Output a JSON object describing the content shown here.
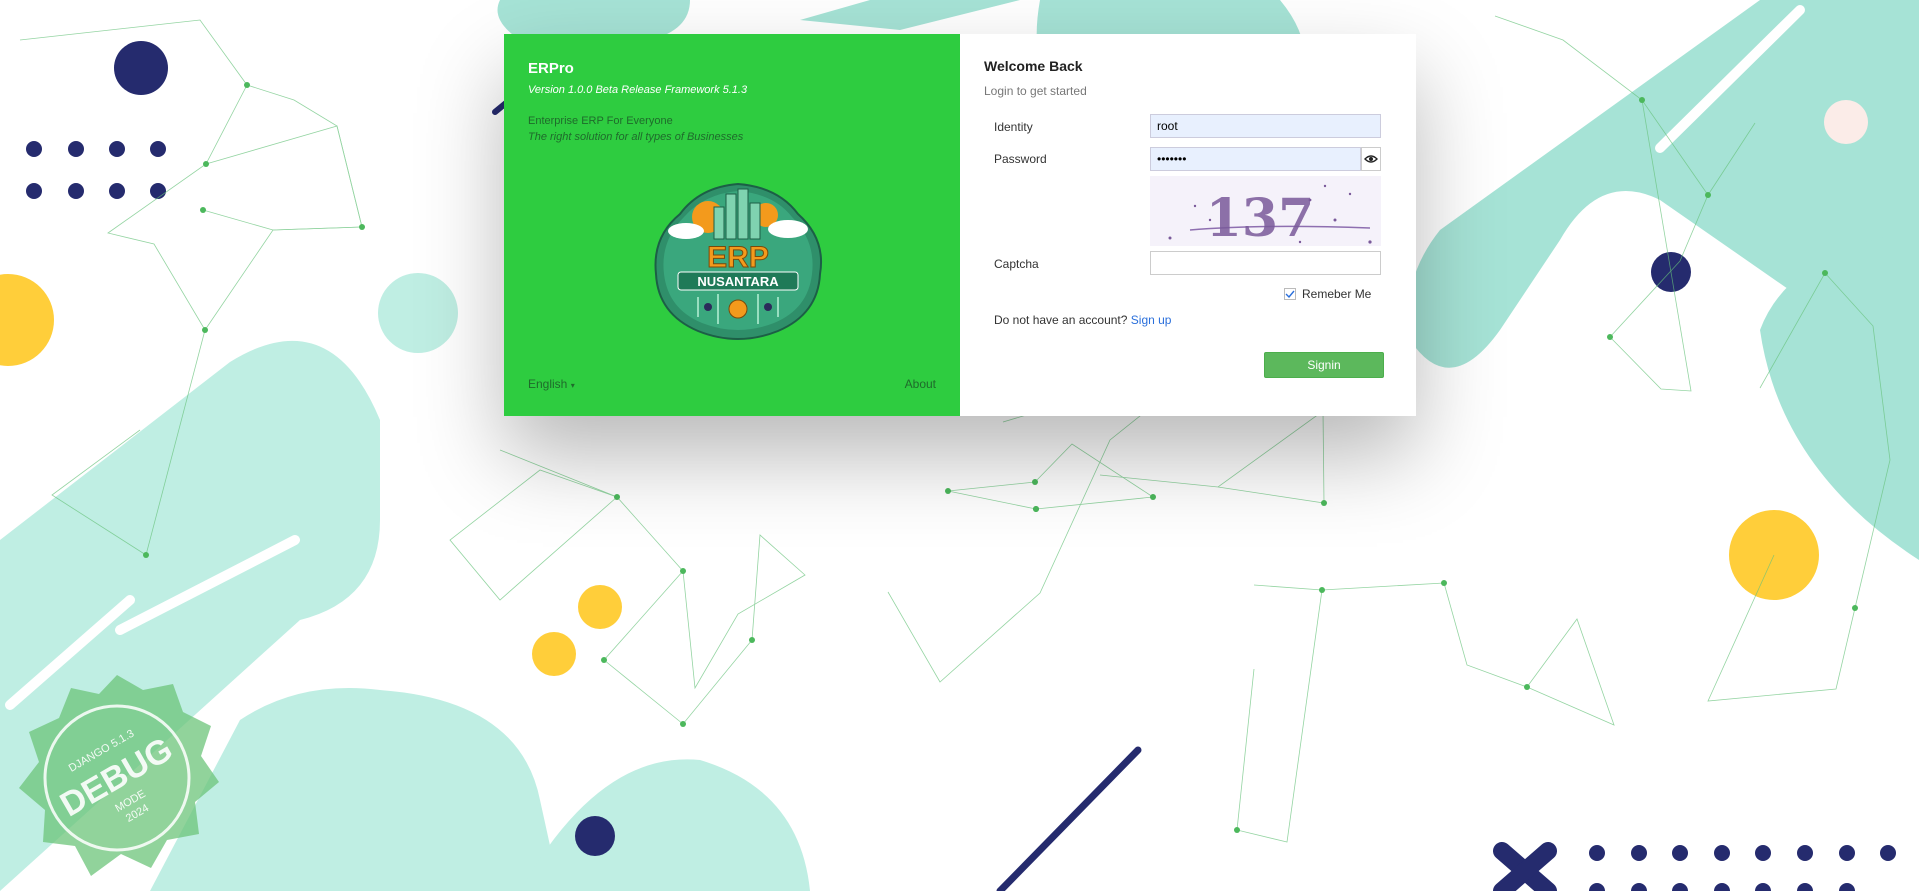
{
  "app": {
    "name": "ERPro",
    "version": "Version 1.0.0 Beta Release Framework 5.1.3",
    "tagline": "Enterprise ERP For Everyone",
    "subtagline": "The right solution for all types of Businesses",
    "logo_text": "ERP",
    "logo_sub": "NUSANTARA"
  },
  "footer": {
    "language": "English",
    "about": "About"
  },
  "login": {
    "title": "Welcome Back",
    "subtitle": "Login to get started",
    "identity_label": "Identity",
    "identity_value": "root",
    "password_label": "Password",
    "password_value": "•••••••",
    "captcha_label": "Captcha",
    "captcha_value": "",
    "captcha_text": "137",
    "remember_label": "Remeber Me",
    "no_account_text": "Do not have an account?",
    "signup_label": "Sign up",
    "signin_label": "Signin"
  },
  "debug_stamp": {
    "line1": "DJANGO 5.1.3",
    "line2": "DEBUG",
    "line3": "MODE",
    "line4": "2024"
  },
  "colors": {
    "green_panel": "#2ecc40",
    "teal": "#a8e4d8",
    "navy": "#252b6e",
    "yellow": "#ffce3a",
    "button": "#5cb85c"
  },
  "icons": [
    "eye-icon",
    "checkbox-checked-icon",
    "caret-down-icon"
  ]
}
